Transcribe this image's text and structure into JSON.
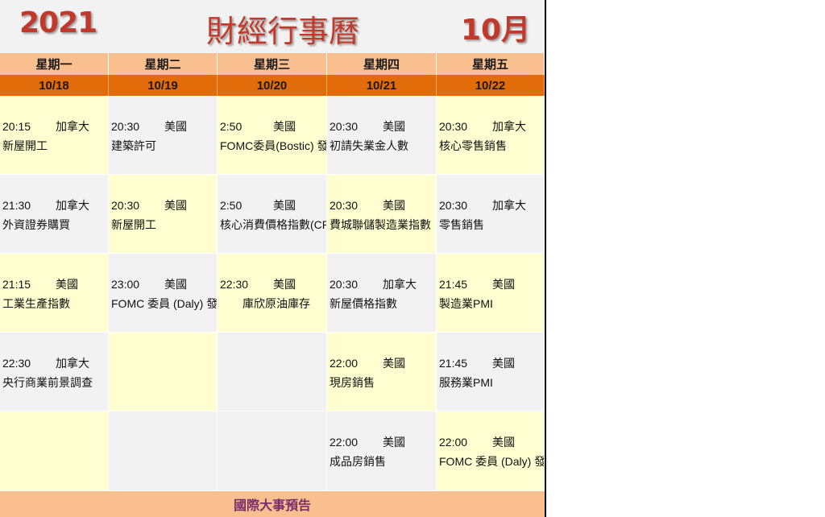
{
  "header": {
    "year": "2021",
    "title": "財經行事曆",
    "month": "10月"
  },
  "days": [
    "星期一",
    "星期二",
    "星期三",
    "星期四",
    "星期五"
  ],
  "dates": [
    "10/18",
    "10/19",
    "10/20",
    "10/21",
    "10/22"
  ],
  "rows": [
    [
      {
        "time": "20:15",
        "country": "加拿大",
        "event": "新屋開工"
      },
      {
        "time": "20:30",
        "country": "美國",
        "event": "建築許可"
      },
      {
        "time": "2:50",
        "country": "美國",
        "event": "FOMC委員(Bostic) 發言"
      },
      {
        "time": "20:30",
        "country": "美國",
        "event": "初請失業金人數"
      },
      {
        "time": "20:30",
        "country": "加拿大",
        "event": "核心零售銷售"
      }
    ],
    [
      {
        "time": "21:30",
        "country": "加拿大",
        "event": "外資證券購買"
      },
      {
        "time": "20:30",
        "country": "美國",
        "event": "新屋開工"
      },
      {
        "time": "2:50",
        "country": "美國",
        "event": "核心消費價格指數(CPI)"
      },
      {
        "time": "20:30",
        "country": "美國",
        "event": "費城聯儲製造業指數"
      },
      {
        "time": "20:30",
        "country": "加拿大",
        "event": "零售銷售"
      }
    ],
    [
      {
        "time": "21:15",
        "country": "美國",
        "event": "工業生產指數"
      },
      {
        "time": "23:00",
        "country": "美國",
        "event": "FOMC 委員 (Daly) 發言"
      },
      {
        "time": "22:30",
        "country": "美國",
        "event": "庫欣原油庫存"
      },
      {
        "time": "20:30",
        "country": "加拿大",
        "event": "新屋價格指數"
      },
      {
        "time": "21:45",
        "country": "美國",
        "event": "製造業PMI"
      }
    ],
    [
      {
        "time": "22:30",
        "country": "加拿大",
        "event": "央行商業前景調查"
      },
      {
        "time": "",
        "country": "",
        "event": ""
      },
      {
        "time": "",
        "country": "",
        "event": ""
      },
      {
        "time": "22:00",
        "country": "美國",
        "event": "現房銷售"
      },
      {
        "time": "21:45",
        "country": "美國",
        "event": "服務業PMI"
      }
    ],
    [
      {
        "time": "",
        "country": "",
        "event": ""
      },
      {
        "time": "",
        "country": "",
        "event": ""
      },
      {
        "time": "",
        "country": "",
        "event": ""
      },
      {
        "time": "22:00",
        "country": "美國",
        "event": "成品房銷售"
      },
      {
        "time": "22:00",
        "country": "美國",
        "event": "FOMC 委員 (Daly) 發言"
      }
    ]
  ],
  "footer": "國際大事預告",
  "colors": {
    "title_red": "#c0392b",
    "day_header": "#f9bf8f",
    "date_header": "#e26b0a",
    "cell_yellow": "#fefed0",
    "cell_gray": "#f2f2f2",
    "footer_text": "#7b2d6b"
  }
}
